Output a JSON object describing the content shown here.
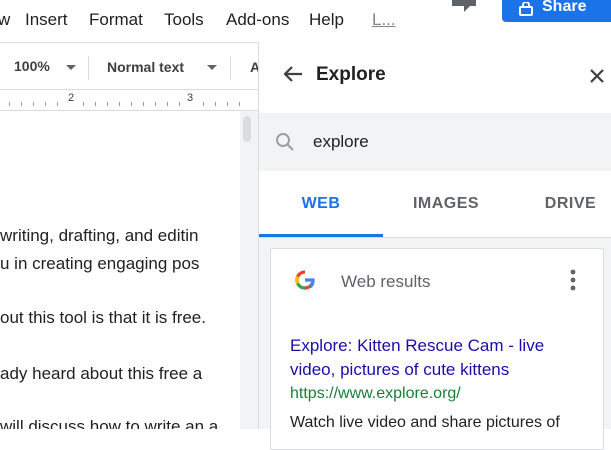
{
  "menu": {
    "items": [
      "w",
      "Insert",
      "Format",
      "Tools",
      "Add-ons",
      "Help",
      "L..."
    ]
  },
  "share": {
    "label": "Share"
  },
  "toolbar": {
    "zoom": "100%",
    "paragraph_style": "Normal text",
    "font_cut": "A"
  },
  "ruler": {
    "numbers": [
      "2",
      "3"
    ]
  },
  "document": {
    "lines": [
      " writing, drafting, and editin",
      "u in creating engaging pos",
      "out this tool is that it is free.",
      "ady heard about this free a",
      "will discuss how to write an a"
    ]
  },
  "explore": {
    "title": "Explore",
    "search": {
      "value": "explore"
    },
    "tabs": [
      "WEB",
      "IMAGES",
      "DRIVE"
    ],
    "active_tab": "WEB",
    "card": {
      "header": "Web results",
      "result_title": "Explore: Kitten Rescue Cam - live video, pictures of cute kittens",
      "result_url": "https://www.explore.org/",
      "result_snippet": "Watch live video and share pictures of"
    }
  },
  "colors": {
    "accent": "#1a73e8",
    "link": "#1a0dab",
    "url_green": "#188038",
    "panel_bg": "#f1f3f4"
  },
  "icons": [
    "chat-icon",
    "lock-icon",
    "caret-down-icon",
    "back-arrow-icon",
    "close-icon",
    "search-icon",
    "google-logo-icon",
    "more-vert-icon"
  ]
}
